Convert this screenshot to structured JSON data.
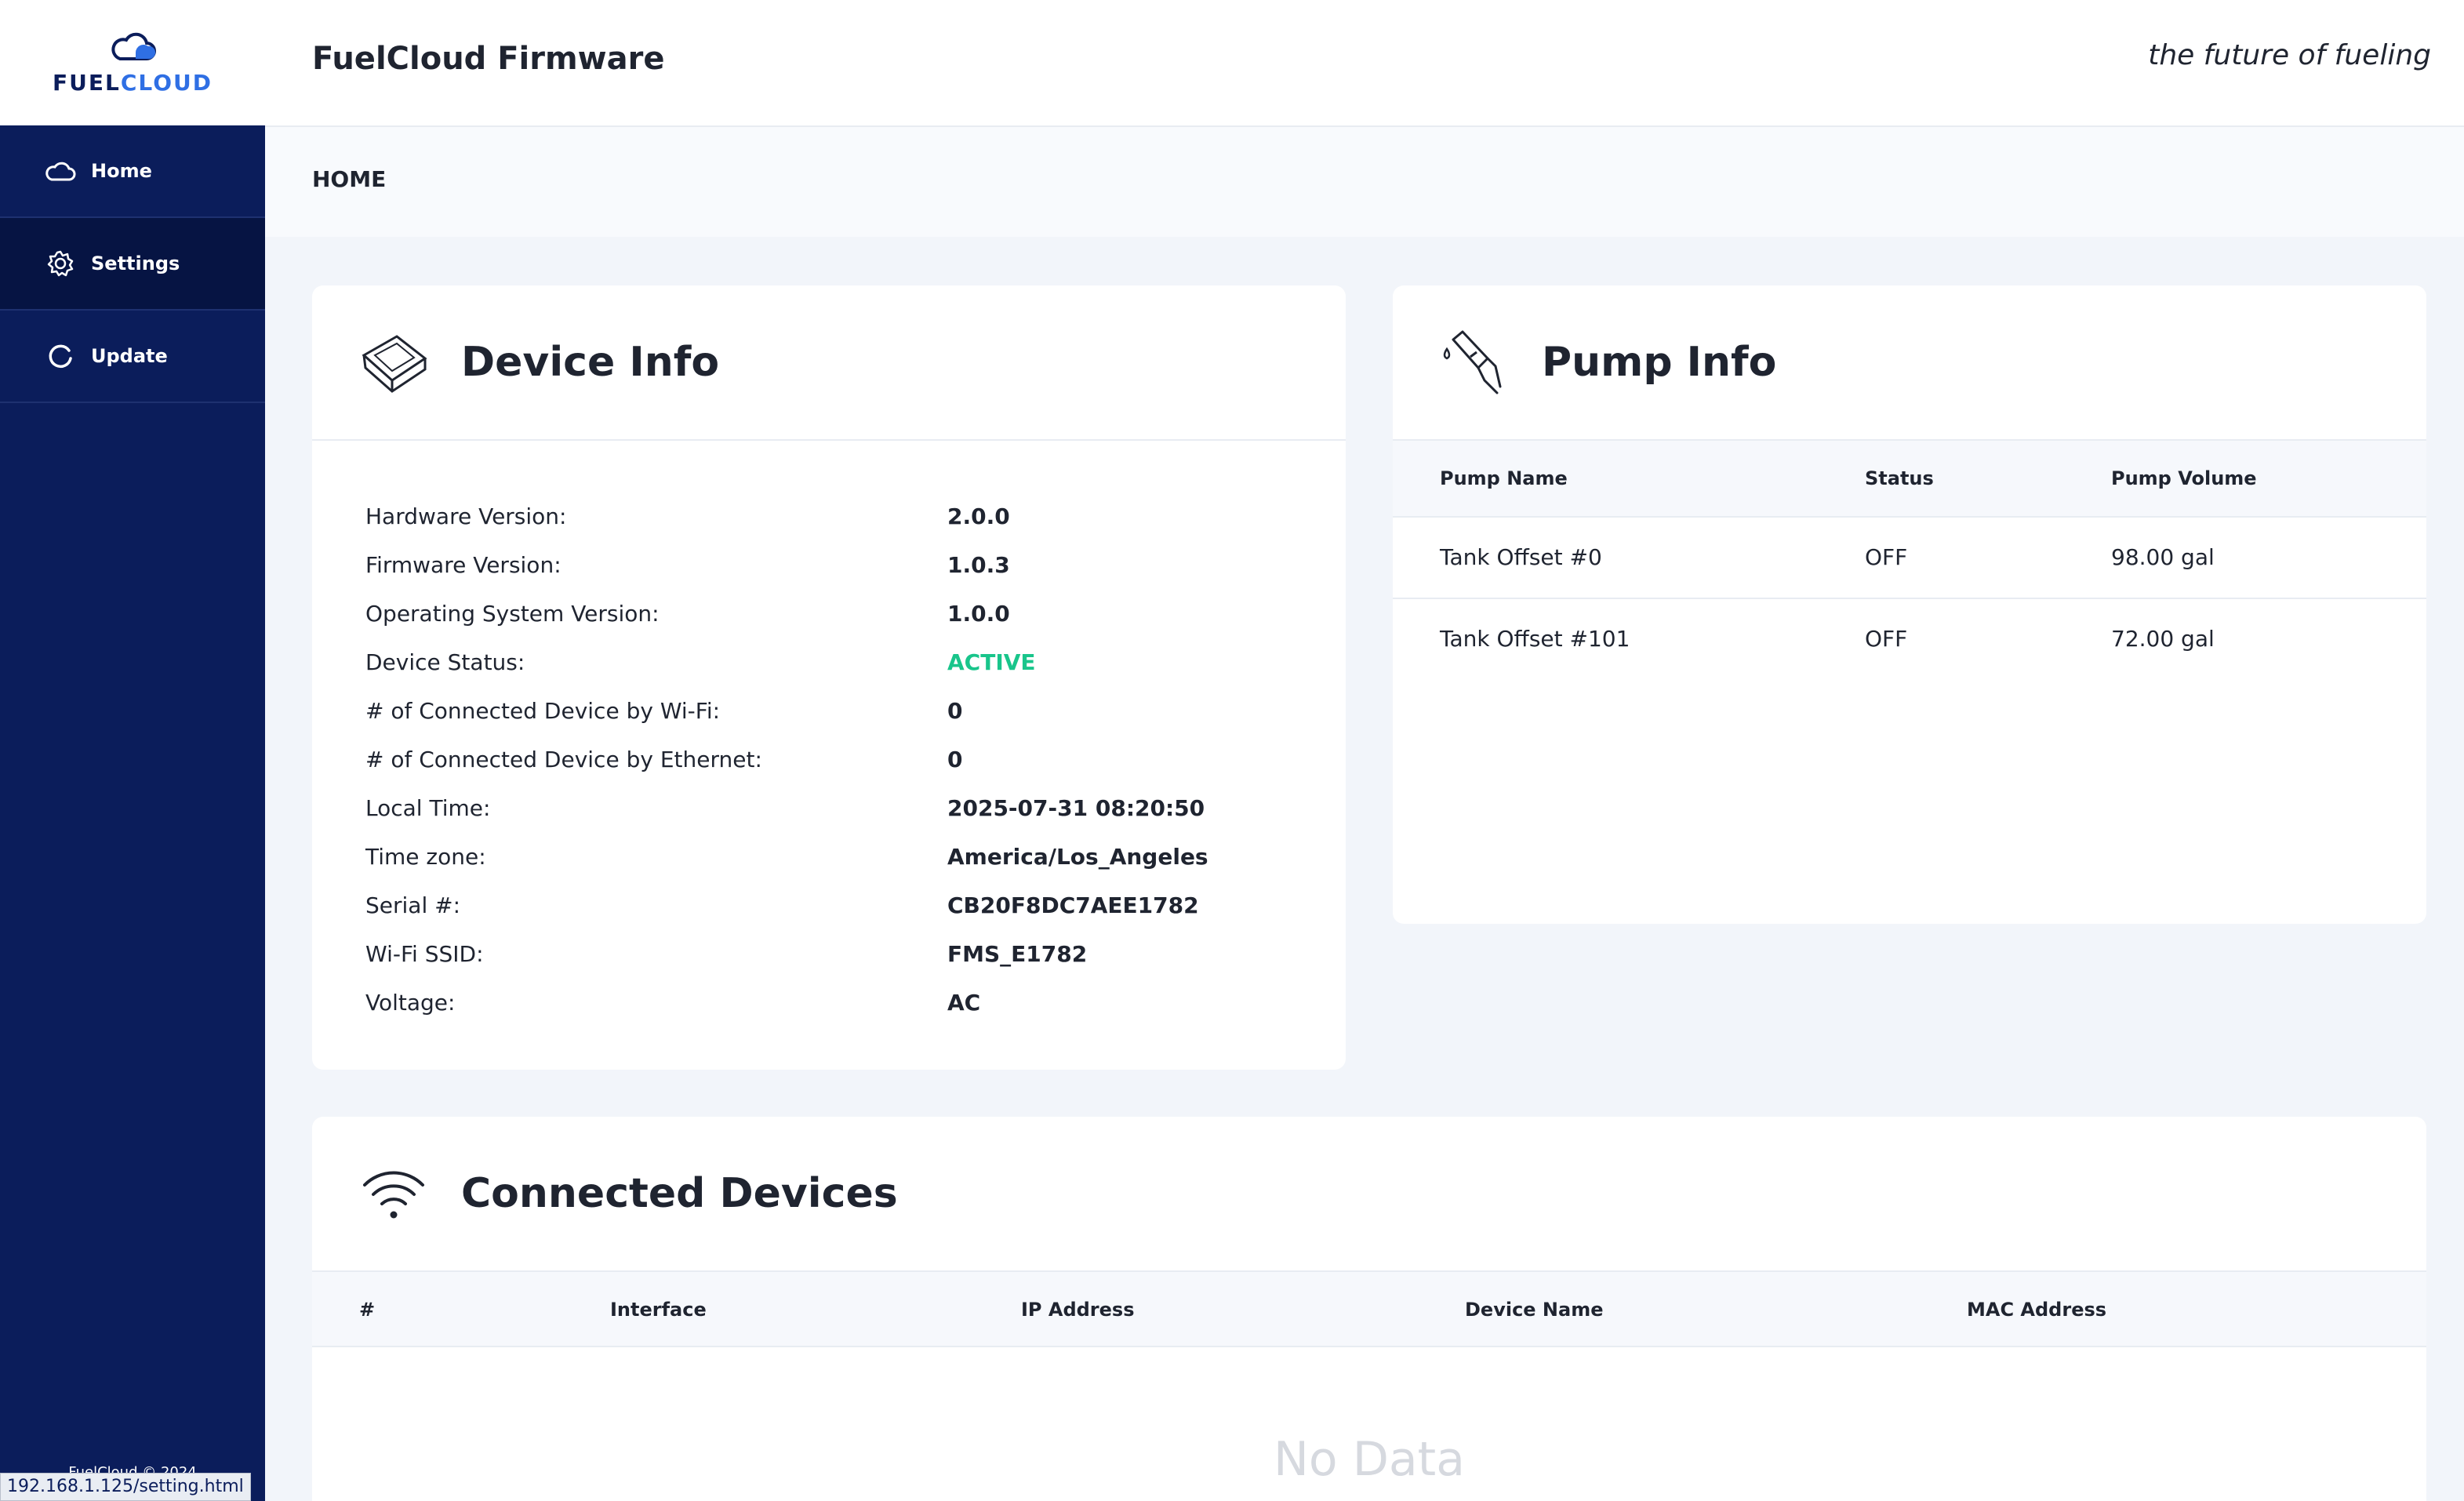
{
  "brand": {
    "logo_fuel": "FUEL",
    "logo_cloud": "CLOUD",
    "footer": "FuelCloud © 2024"
  },
  "sidebar": {
    "items": [
      {
        "label": "Home",
        "icon": "cloud-icon"
      },
      {
        "label": "Settings",
        "icon": "gear-icon"
      },
      {
        "label": "Update",
        "icon": "refresh-icon"
      }
    ]
  },
  "header": {
    "title": "FuelCloud Firmware",
    "tagline": "the future of fueling"
  },
  "breadcrumb": "HOME",
  "device_info": {
    "title": "Device Info",
    "rows": [
      {
        "label": "Hardware Version:",
        "value": "2.0.0"
      },
      {
        "label": "Firmware Version:",
        "value": "1.0.3"
      },
      {
        "label": "Operating System Version:",
        "value": "1.0.0"
      },
      {
        "label": "Device Status:",
        "value": "ACTIVE"
      },
      {
        "label": "# of Connected Device by Wi-Fi:",
        "value": "0"
      },
      {
        "label": "# of Connected Device by Ethernet:",
        "value": "0"
      },
      {
        "label": "Local Time:",
        "value": "2025-07-31 08:20:50"
      },
      {
        "label": "Time zone:",
        "value": "America/Los_Angeles"
      },
      {
        "label": "Serial #:",
        "value": "CB20F8DC7AEE1782"
      },
      {
        "label": "Wi-Fi SSID:",
        "value": "FMS_E1782"
      },
      {
        "label": "Voltage:",
        "value": "AC"
      }
    ],
    "status_color": "#19c58b"
  },
  "pump_info": {
    "title": "Pump Info",
    "columns": [
      "Pump Name",
      "Status",
      "Pump Volume"
    ],
    "rows": [
      {
        "name": "Tank Offset #0",
        "status": "OFF",
        "volume": "98.00 gal"
      },
      {
        "name": "Tank Offset #101",
        "status": "OFF",
        "volume": "72.00 gal"
      }
    ]
  },
  "connected_devices": {
    "title": "Connected Devices",
    "columns": [
      "#",
      "Interface",
      "IP Address",
      "Device Name",
      "MAC Address"
    ],
    "empty_text": "No Data"
  },
  "status_bar_url": "192.168.1.125/setting.html",
  "colors": {
    "sidebar_bg": "#0b1d5b",
    "sidebar_active": "#061443",
    "accent_blue": "#2f6fe4",
    "active_green": "#19c58b"
  }
}
